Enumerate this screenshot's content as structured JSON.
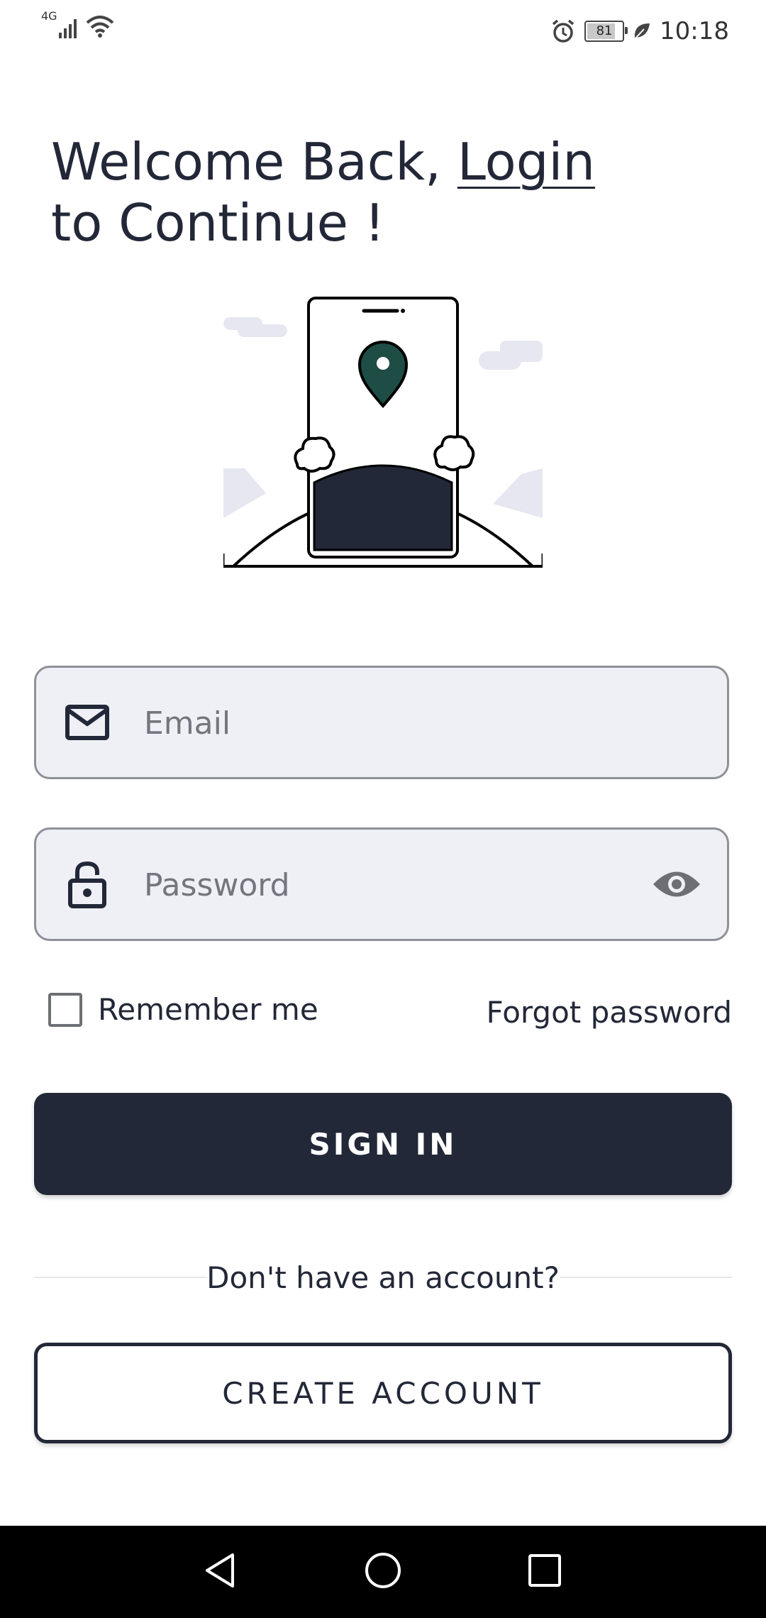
{
  "status_bar": {
    "network": "4G",
    "battery": "81",
    "battery_fraction": 0.81,
    "time": "10:18"
  },
  "heading": {
    "line1_prefix": "Welcome Back, ",
    "link": "Login",
    "line2": "to Continue !"
  },
  "email": {
    "placeholder": "Email",
    "value": ""
  },
  "password": {
    "placeholder": "Password",
    "value": ""
  },
  "remember_me": {
    "label": "Remember me",
    "checked": false
  },
  "forgot_password": "Forgot password",
  "sign_in_label": "SIGN IN",
  "divider_text": "Don't have an account?",
  "create_account_label": "CREATE ACCOUNT",
  "colors": {
    "primary": "#232838",
    "field_bg": "#eef0f5",
    "pin_green": "#1e4d45",
    "illustration_accent": "#e6e7f0"
  },
  "icons": {
    "email": "mail-icon",
    "password": "lock-icon",
    "visibility": "eye-icon"
  }
}
